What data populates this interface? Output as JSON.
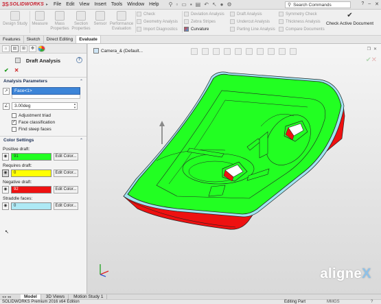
{
  "app": {
    "brand": "SOLIDWORKS",
    "menus": [
      "File",
      "Edit",
      "View",
      "Insert",
      "Tools",
      "Window",
      "Help"
    ],
    "search_placeholder": "Search Commands"
  },
  "ribbon": {
    "big_buttons": [
      "Design Study",
      "Measure",
      "Mass Properties",
      "Section Properties",
      "Sensor",
      "Performance Evaluation"
    ],
    "col1": [
      "Check",
      "Geometry Analysis",
      "Import Diagnostics"
    ],
    "col2": [
      "Deviation Analysis",
      "Zebra Stripes",
      "Curvature"
    ],
    "col3": [
      "Draft Analysis",
      "Undercut Analysis",
      "Parting Line Analysis"
    ],
    "col4": [
      "Symmetry Check",
      "Thickness Analysis",
      "Compare Documents"
    ],
    "check_active": "Check Active Document"
  },
  "cm_tabs": [
    "Features",
    "Sketch",
    "Direct Editing",
    "Evaluate"
  ],
  "propertymanager": {
    "title": "Draft Analysis",
    "params_header": "Analysis Parameters",
    "face_value": "Face<1>",
    "angle_value": "3.00deg",
    "opt_adjust": "Adjustment triad",
    "opt_face_class": "Face classification",
    "opt_steep": "Find steep faces",
    "color_header": "Color Settings",
    "positive_label": "Positive draft:",
    "positive_count": "91",
    "requires_label": "Requires draft:",
    "requires_count": "0",
    "negative_label": "Negative draft:",
    "negative_count": "92",
    "straddle_label": "Straddle faces:",
    "straddle_count": "0",
    "edit_color": "Edit Color..."
  },
  "colors": {
    "positive": "#22ff22",
    "requires": "#ffff00",
    "negative": "#ee1111",
    "straddle": "#aee9f5"
  },
  "viewport": {
    "title": "Camera_& (Default..."
  },
  "watermark": {
    "a": "aligne",
    "b": "X"
  },
  "bottom_tabs": [
    "Model",
    "3D Views",
    "Motion Study 1"
  ],
  "status": {
    "edition": "SOLIDWORKS Premium 2016 x64 Edition",
    "mode": "Editing Part",
    "units": "MMGS"
  }
}
